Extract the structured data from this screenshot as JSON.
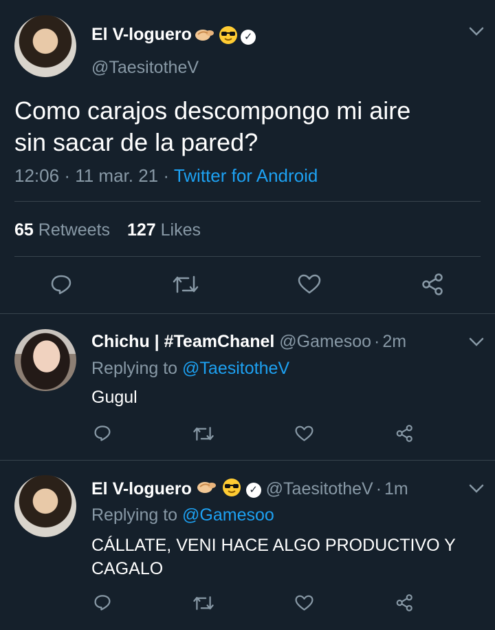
{
  "main_tweet": {
    "author_name": "El V-loguero",
    "author_handle": "@TaesitotheV",
    "text_line1": "Como carajos descompongo mi aire",
    "text_line2": "sin sacar de la pared?",
    "time": "12:06",
    "date": "11 mar. 21",
    "source": "Twitter for Android",
    "separator": "·",
    "retweets_count": "65",
    "retweets_label": "Retweets",
    "likes_count": "127",
    "likes_label": "Likes"
  },
  "replies": [
    {
      "author_name": "Chichu | #TeamChanel",
      "author_handle": "@Gamesoo",
      "time": "2m",
      "replying_label": "Replying to",
      "replying_to": "@TaesitotheV",
      "text_line1": "Gugul",
      "text_line2": ""
    },
    {
      "author_name": "El V-loguero",
      "author_handle": "@TaesitotheV",
      "time": "1m",
      "replying_label": "Replying to",
      "replying_to": "@Gamesoo",
      "text_line1": "CÁLLATE, VENI HACE ALGO PRODUCTIVO Y",
      "text_line2": "CAGALO"
    }
  ],
  "icons": {
    "reply": "reply-icon",
    "retweet": "retweet-icon",
    "like": "like-icon",
    "share": "share-icon",
    "more": "chevron-down-icon",
    "verified": "verified-badge-icon"
  },
  "colors": {
    "background": "#15202b",
    "text": "#ffffff",
    "muted": "#8899a6",
    "link": "#1da1f2",
    "divider": "#38444d"
  }
}
